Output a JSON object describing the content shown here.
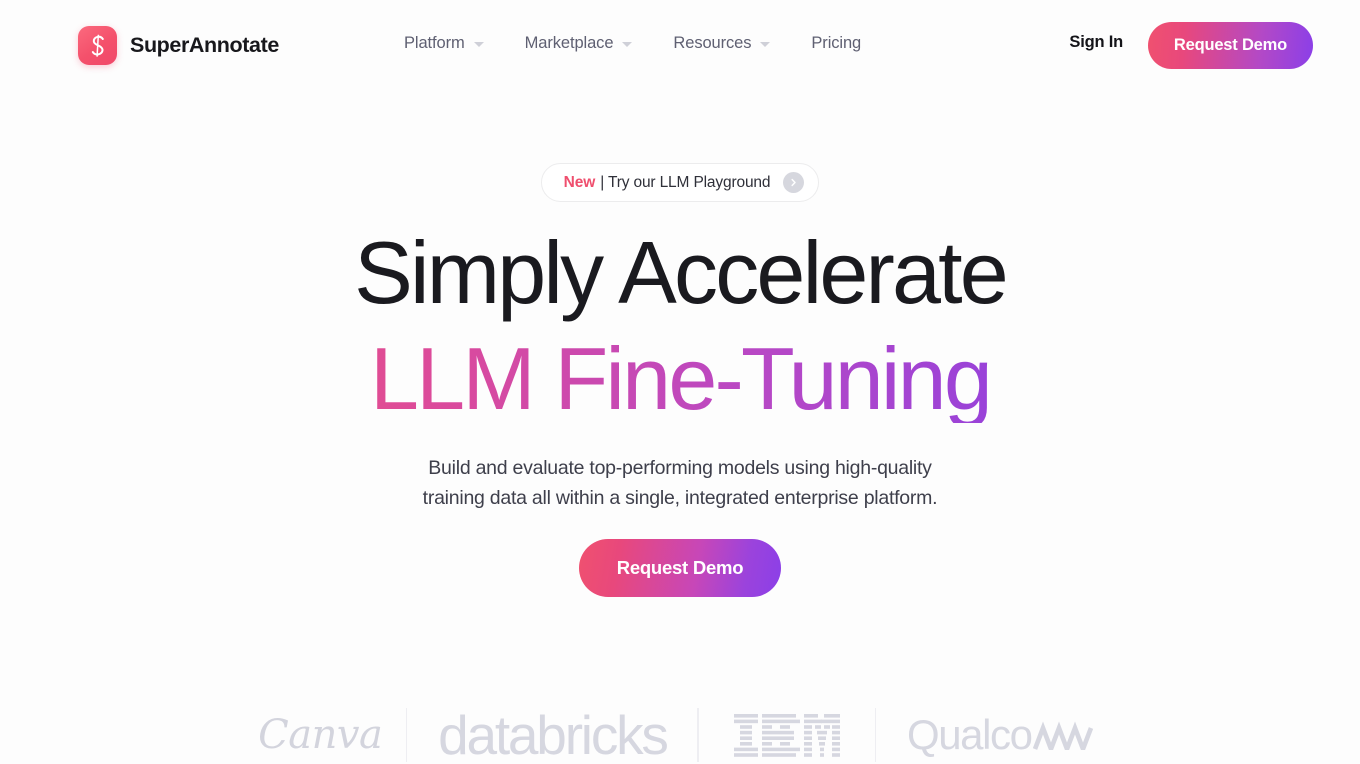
{
  "brand": {
    "name": "SuperAnnotate",
    "mark_letter": "S",
    "mark_color_start": "#fb6a7e",
    "mark_color_end": "#f0486a",
    "icon": "superannotate-logo-icon"
  },
  "nav": {
    "items": [
      {
        "label": "Platform",
        "has_dropdown": true
      },
      {
        "label": "Marketplace",
        "has_dropdown": true
      },
      {
        "label": "Resources",
        "has_dropdown": true
      },
      {
        "label": "Pricing",
        "has_dropdown": false
      }
    ],
    "sign_in": "Sign In",
    "request_demo": "Request Demo"
  },
  "hero": {
    "announcement": {
      "badge": "New",
      "separator": "|",
      "text": "Try our LLM Playground",
      "arrow_icon": "chevron-right-icon"
    },
    "headline_line1": "Simply Accelerate",
    "headline_line2": "LLM Fine-Tuning",
    "headline_gradient_start": "#f4556c",
    "headline_gradient_end": "#7340ea",
    "subtitle_line1": "Build and evaluate top-performing models using high-quality",
    "subtitle_line2": "training data all within a single, integrated enterprise platform.",
    "cta_label": "Request Demo",
    "cta_gradient_start": "#f0516f",
    "cta_gradient_end": "#8b3fe8"
  },
  "logos": {
    "color": "#d6d7e0",
    "items": [
      {
        "name": "Canva"
      },
      {
        "name": "databricks"
      },
      {
        "name": "IBM"
      },
      {
        "name": "Qualcomm"
      }
    ],
    "qualcomm_head": "Qualco",
    "qualcomm_tail": "mm"
  }
}
